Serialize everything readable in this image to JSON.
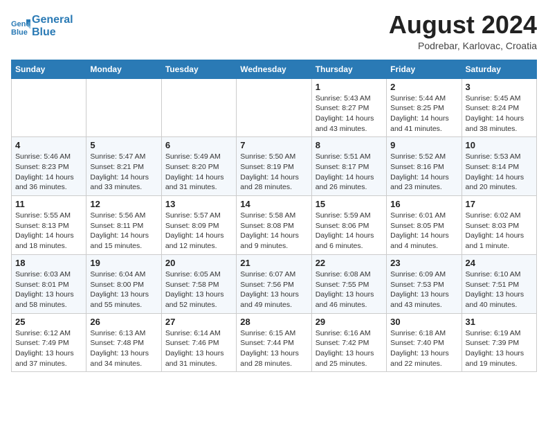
{
  "header": {
    "logo_line1": "General",
    "logo_line2": "Blue",
    "month_year": "August 2024",
    "location": "Podrebar, Karlovac, Croatia"
  },
  "weekdays": [
    "Sunday",
    "Monday",
    "Tuesday",
    "Wednesday",
    "Thursday",
    "Friday",
    "Saturday"
  ],
  "weeks": [
    [
      {
        "day": "",
        "info": ""
      },
      {
        "day": "",
        "info": ""
      },
      {
        "day": "",
        "info": ""
      },
      {
        "day": "",
        "info": ""
      },
      {
        "day": "1",
        "info": "Sunrise: 5:43 AM\nSunset: 8:27 PM\nDaylight: 14 hours\nand 43 minutes."
      },
      {
        "day": "2",
        "info": "Sunrise: 5:44 AM\nSunset: 8:25 PM\nDaylight: 14 hours\nand 41 minutes."
      },
      {
        "day": "3",
        "info": "Sunrise: 5:45 AM\nSunset: 8:24 PM\nDaylight: 14 hours\nand 38 minutes."
      }
    ],
    [
      {
        "day": "4",
        "info": "Sunrise: 5:46 AM\nSunset: 8:23 PM\nDaylight: 14 hours\nand 36 minutes."
      },
      {
        "day": "5",
        "info": "Sunrise: 5:47 AM\nSunset: 8:21 PM\nDaylight: 14 hours\nand 33 minutes."
      },
      {
        "day": "6",
        "info": "Sunrise: 5:49 AM\nSunset: 8:20 PM\nDaylight: 14 hours\nand 31 minutes."
      },
      {
        "day": "7",
        "info": "Sunrise: 5:50 AM\nSunset: 8:19 PM\nDaylight: 14 hours\nand 28 minutes."
      },
      {
        "day": "8",
        "info": "Sunrise: 5:51 AM\nSunset: 8:17 PM\nDaylight: 14 hours\nand 26 minutes."
      },
      {
        "day": "9",
        "info": "Sunrise: 5:52 AM\nSunset: 8:16 PM\nDaylight: 14 hours\nand 23 minutes."
      },
      {
        "day": "10",
        "info": "Sunrise: 5:53 AM\nSunset: 8:14 PM\nDaylight: 14 hours\nand 20 minutes."
      }
    ],
    [
      {
        "day": "11",
        "info": "Sunrise: 5:55 AM\nSunset: 8:13 PM\nDaylight: 14 hours\nand 18 minutes."
      },
      {
        "day": "12",
        "info": "Sunrise: 5:56 AM\nSunset: 8:11 PM\nDaylight: 14 hours\nand 15 minutes."
      },
      {
        "day": "13",
        "info": "Sunrise: 5:57 AM\nSunset: 8:09 PM\nDaylight: 14 hours\nand 12 minutes."
      },
      {
        "day": "14",
        "info": "Sunrise: 5:58 AM\nSunset: 8:08 PM\nDaylight: 14 hours\nand 9 minutes."
      },
      {
        "day": "15",
        "info": "Sunrise: 5:59 AM\nSunset: 8:06 PM\nDaylight: 14 hours\nand 6 minutes."
      },
      {
        "day": "16",
        "info": "Sunrise: 6:01 AM\nSunset: 8:05 PM\nDaylight: 14 hours\nand 4 minutes."
      },
      {
        "day": "17",
        "info": "Sunrise: 6:02 AM\nSunset: 8:03 PM\nDaylight: 14 hours\nand 1 minute."
      }
    ],
    [
      {
        "day": "18",
        "info": "Sunrise: 6:03 AM\nSunset: 8:01 PM\nDaylight: 13 hours\nand 58 minutes."
      },
      {
        "day": "19",
        "info": "Sunrise: 6:04 AM\nSunset: 8:00 PM\nDaylight: 13 hours\nand 55 minutes."
      },
      {
        "day": "20",
        "info": "Sunrise: 6:05 AM\nSunset: 7:58 PM\nDaylight: 13 hours\nand 52 minutes."
      },
      {
        "day": "21",
        "info": "Sunrise: 6:07 AM\nSunset: 7:56 PM\nDaylight: 13 hours\nand 49 minutes."
      },
      {
        "day": "22",
        "info": "Sunrise: 6:08 AM\nSunset: 7:55 PM\nDaylight: 13 hours\nand 46 minutes."
      },
      {
        "day": "23",
        "info": "Sunrise: 6:09 AM\nSunset: 7:53 PM\nDaylight: 13 hours\nand 43 minutes."
      },
      {
        "day": "24",
        "info": "Sunrise: 6:10 AM\nSunset: 7:51 PM\nDaylight: 13 hours\nand 40 minutes."
      }
    ],
    [
      {
        "day": "25",
        "info": "Sunrise: 6:12 AM\nSunset: 7:49 PM\nDaylight: 13 hours\nand 37 minutes."
      },
      {
        "day": "26",
        "info": "Sunrise: 6:13 AM\nSunset: 7:48 PM\nDaylight: 13 hours\nand 34 minutes."
      },
      {
        "day": "27",
        "info": "Sunrise: 6:14 AM\nSunset: 7:46 PM\nDaylight: 13 hours\nand 31 minutes."
      },
      {
        "day": "28",
        "info": "Sunrise: 6:15 AM\nSunset: 7:44 PM\nDaylight: 13 hours\nand 28 minutes."
      },
      {
        "day": "29",
        "info": "Sunrise: 6:16 AM\nSunset: 7:42 PM\nDaylight: 13 hours\nand 25 minutes."
      },
      {
        "day": "30",
        "info": "Sunrise: 6:18 AM\nSunset: 7:40 PM\nDaylight: 13 hours\nand 22 minutes."
      },
      {
        "day": "31",
        "info": "Sunrise: 6:19 AM\nSunset: 7:39 PM\nDaylight: 13 hours\nand 19 minutes."
      }
    ]
  ]
}
